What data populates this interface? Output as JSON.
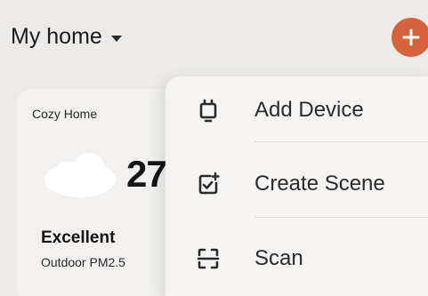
{
  "header": {
    "home_name": "My home"
  },
  "card": {
    "title": "Cozy Home",
    "temperature": "27",
    "air_quality": "Excellent",
    "air_quality_label": "Outdoor PM2.5"
  },
  "menu": {
    "items": [
      {
        "label": "Add Device",
        "icon": "device-icon"
      },
      {
        "label": "Create Scene",
        "icon": "scene-icon"
      },
      {
        "label": "Scan",
        "icon": "scan-icon"
      }
    ]
  },
  "colors": {
    "accent": "#d5613d",
    "background": "#ecebe9",
    "menu_background": "#f5f4f2"
  }
}
